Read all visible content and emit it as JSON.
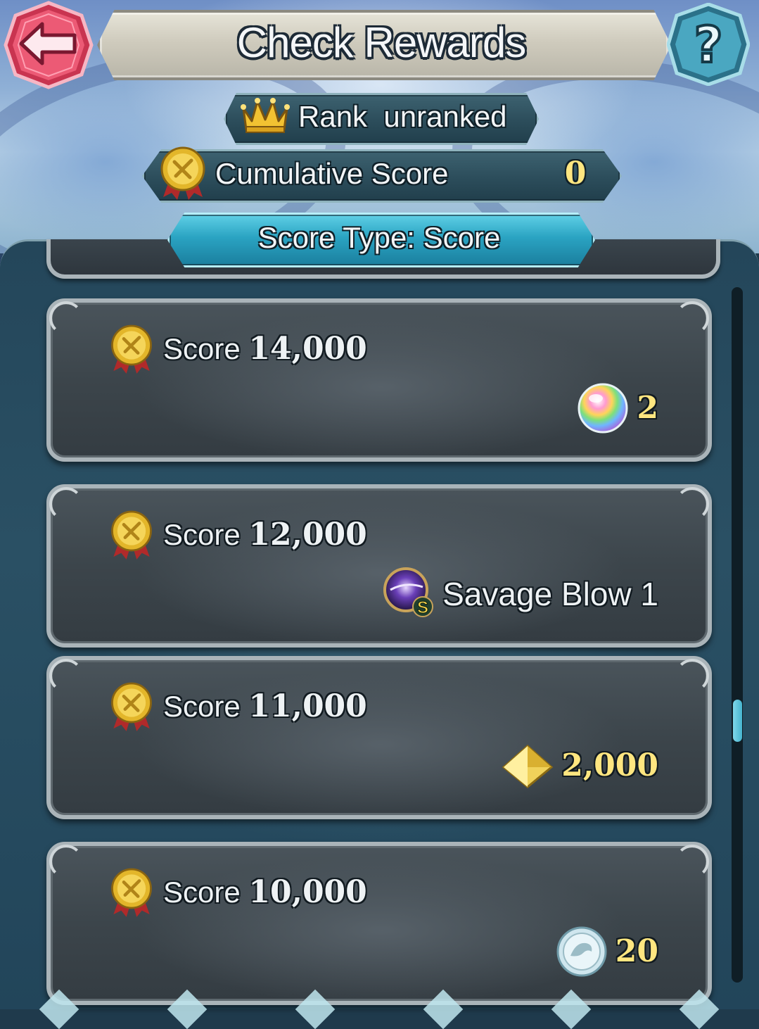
{
  "header": {
    "title": "Check Rewards",
    "back_icon": "arrow-left-icon",
    "help_label": "?"
  },
  "rank": {
    "label": "Rank",
    "value": "unranked",
    "icon": "crown-icon"
  },
  "cumulative": {
    "label": "Cumulative Score",
    "value": "0",
    "icon": "score-medal-icon"
  },
  "score_type": {
    "label": "Score Type: Score"
  },
  "rewards": [
    {
      "score_label": "Score",
      "score_value": "14,000",
      "reward_icon": "orb-icon",
      "reward_text": "2",
      "reward_kind": "quantity"
    },
    {
      "score_label": "Score",
      "score_value": "12,000",
      "reward_icon": "sacred-seal-skill-icon",
      "reward_badge": "S",
      "reward_text": "Savage Blow 1",
      "reward_kind": "skill"
    },
    {
      "score_label": "Score",
      "score_value": "11,000",
      "reward_icon": "feather-icon",
      "reward_text": "2,000",
      "reward_kind": "quantity"
    },
    {
      "score_label": "Score",
      "score_value": "10,000",
      "reward_icon": "sacred-coin-icon",
      "reward_text": "20",
      "reward_kind": "quantity"
    }
  ],
  "colors": {
    "qty_text": "#ffe680",
    "back_button": "#e8506c",
    "help_button": "#3f9bb4",
    "type_pill": "#2aa3c2"
  }
}
